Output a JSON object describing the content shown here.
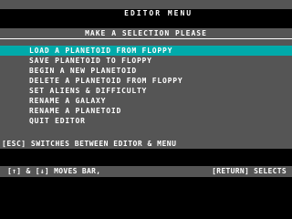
{
  "title_bar": {
    "title": "EDITOR MENU"
  },
  "panel": {
    "header": "MAKE A SELECTION PLEASE",
    "items": [
      {
        "label": "LOAD A PLANETOID FROM FLOPPY",
        "selected": true
      },
      {
        "label": "SAVE PLANETOID TO FLOPPY",
        "selected": false
      },
      {
        "label": "BEGIN A NEW PLANETOID",
        "selected": false
      },
      {
        "label": "DELETE A PLANETOID FROM FLOPPY",
        "selected": false
      },
      {
        "label": "SET ALIENS & DIFFICULTY",
        "selected": false
      },
      {
        "label": "RENAME A GALAXY",
        "selected": false
      },
      {
        "label": "RENAME A PLANETOID",
        "selected": false
      },
      {
        "label": "QUIT EDITOR",
        "selected": false
      }
    ],
    "escape_note": "[ESC] SWITCHES BETWEEN EDITOR & MENU"
  },
  "footer": {
    "left": "[↑] & [↓] MOVES BAR,",
    "right": "[RETURN] SELECTS"
  },
  "colors": {
    "background": "#000000",
    "panel": "#555555",
    "highlight": "#00aaaa",
    "text": "#ffffff"
  }
}
